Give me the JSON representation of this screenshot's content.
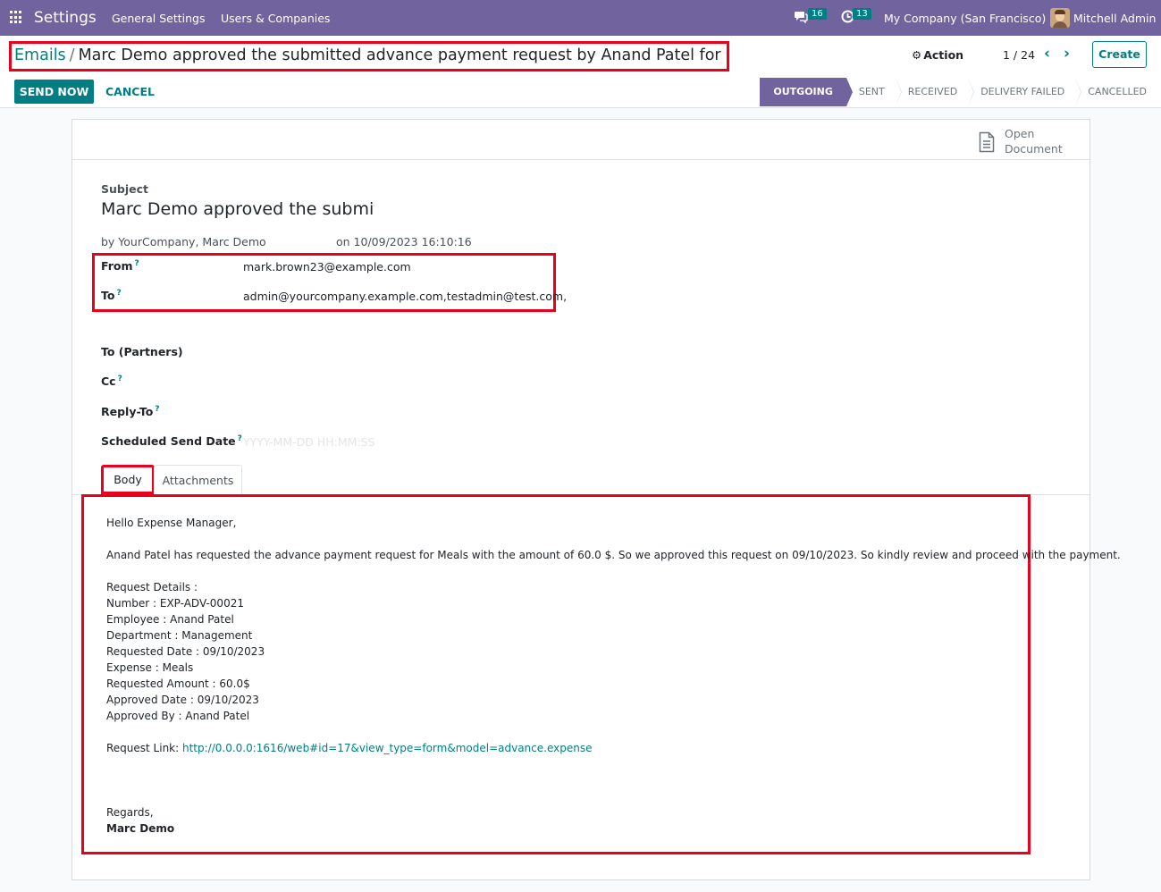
{
  "navbar": {
    "app_name": "Settings",
    "menu": [
      "General Settings",
      "Users & Companies"
    ],
    "messages_icon": "chat-icon",
    "messages_count": "16",
    "activities_icon": "clock-icon",
    "activities_count": "13",
    "company": "My Company (San Francisco)",
    "user": "Mitchell Admin"
  },
  "breadcrumb": {
    "parent": "Emails",
    "separator": "/",
    "current": "Marc Demo approved the submitted advance payment request by Anand Patel for Meals"
  },
  "toolbar": {
    "action_label": "Action",
    "pager_value": "1 / 24",
    "prev_icon": "‹",
    "next_icon": "›",
    "create_label": "Create",
    "send_now_label": "SEND NOW",
    "cancel_label": "CANCEL"
  },
  "statusbar": {
    "items": [
      "OUTGOING",
      "SENT",
      "RECEIVED",
      "DELIVERY FAILED",
      "CANCELLED"
    ],
    "active": "OUTGOING"
  },
  "button_box": {
    "open_document_line1": "Open",
    "open_document_line2": "Document"
  },
  "form": {
    "subject_label": "Subject",
    "subject_value": "Marc Demo approved the submitted advance payment request by Anand Patel for Meals",
    "byline": "by YourCompany, Marc Demo",
    "date_line": "on 10/09/2023 16:10:16",
    "from_label": "From",
    "from_value": "mark.brown23@example.com",
    "to_label": "To",
    "to_value": "admin@yourcompany.example.com,testadmin@test.com,",
    "to_partners_label": "To (Partners)",
    "cc_label": "Cc",
    "reply_to_label": "Reply-To",
    "scheduled_label": "Scheduled Send Date",
    "scheduled_placeholder": "YYYY-MM-DD HH:MM:SS",
    "help_marker": "?"
  },
  "tabs": {
    "body": "Body",
    "attachments": "Attachments"
  },
  "body": {
    "greeting": "Hello Expense Manager,",
    "intro": "Anand Patel has requested the advance payment request for Meals with the amount of 60.0 $. So we approved this request on 09/10/2023. So kindly review and proceed with the payment.",
    "details_header": "Request Details :",
    "details": [
      "Number : EXP-ADV-00021",
      "Employee : Anand Patel",
      "Department : Management",
      "Requested Date : 09/10/2023",
      "Expense : Meals",
      "Requested Amount : 60.0$",
      "Approved Date : 09/10/2023",
      "Approved By : Anand Patel"
    ],
    "link_label": "Request Link: ",
    "link_url": "http://0.0.0.0:1616/web#id=17&view_type=form&model=advance.expense",
    "regards": "Regards,",
    "signature": "Marc Demo"
  }
}
